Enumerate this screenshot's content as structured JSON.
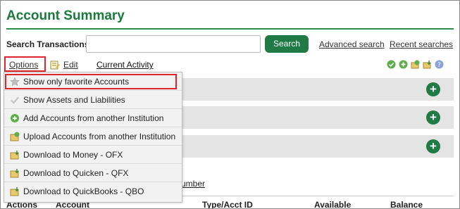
{
  "header": {
    "title": "Account Summary"
  },
  "search": {
    "label": "Search Transactions:",
    "value": "",
    "placeholder": "",
    "button_label": "Search",
    "advanced_link": "Advanced search",
    "recent_link": "Recent searches"
  },
  "toolbar": {
    "options_label": "Options",
    "edit_label": "Edit",
    "activity_label": "Current Activity",
    "icons": [
      "check-icon",
      "add-icon",
      "upload-icon",
      "download-icon",
      "help-icon"
    ]
  },
  "options_menu": {
    "items": [
      {
        "label": "Show only favorite Accounts",
        "icon": "star-icon"
      },
      {
        "label": "Show Assets and Liabilities",
        "icon": "check-icon"
      },
      {
        "label": "Add Accounts from another Institution",
        "icon": "add-icon"
      },
      {
        "label": "Upload Accounts from another Institution",
        "icon": "upload-icon"
      },
      {
        "label": "Download to Money - OFX",
        "icon": "download-icon"
      },
      {
        "label": "Download to Quicken - QFX",
        "icon": "download-icon"
      },
      {
        "label": "Download to QuickBooks - QBO",
        "icon": "download-icon"
      }
    ]
  },
  "accounts": {
    "add_symbol": "+",
    "partial_link": "umber",
    "columns": [
      "Actions",
      "Account",
      "Type/Acct ID",
      "Available",
      "Balance"
    ]
  },
  "colors": {
    "brand_green": "#1f7a45",
    "title_green": "#1a7a3e",
    "highlight_red": "#e0262d"
  }
}
